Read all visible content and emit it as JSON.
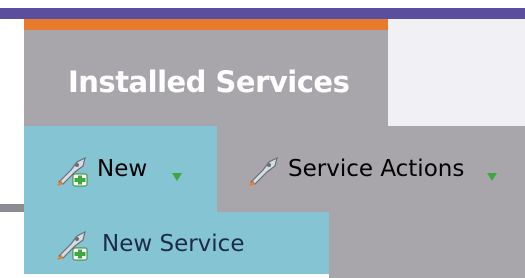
{
  "tabs": {
    "active_label": "Installed Services"
  },
  "toolbar": {
    "new_label": "New",
    "new_icon": "rocket-add-icon",
    "actions_label": "Service Actions",
    "actions_icon": "rocket-icon",
    "caret_icon": "caret-down-icon"
  },
  "dropdown": {
    "items": [
      {
        "label": "New Service",
        "icon": "rocket-add-icon"
      }
    ]
  },
  "colors": {
    "top_bar": "#5b4e9e",
    "tab_accent": "#e87a2c",
    "panel_gray": "#a8a6ab",
    "highlight_blue": "#85c4d2",
    "caret_green": "#3ea83e"
  }
}
